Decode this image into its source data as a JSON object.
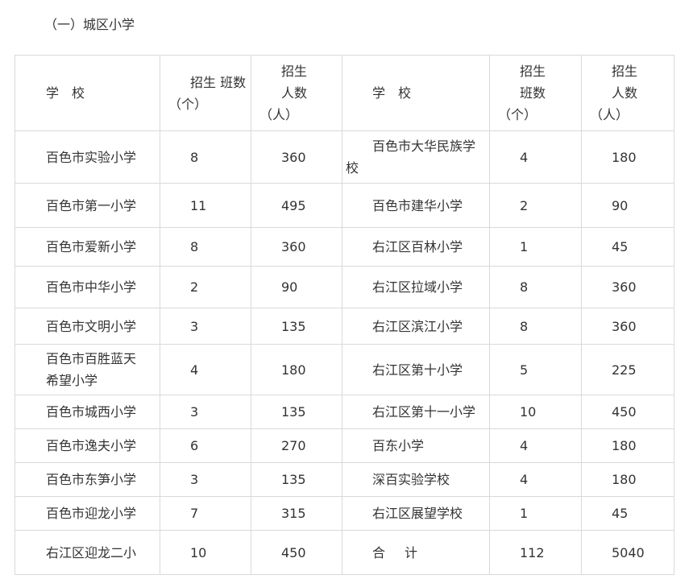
{
  "section_title": "（一）城区小学",
  "header": {
    "school": "学　校",
    "classes_line1": "招生 班数",
    "classes_line2": "（个）",
    "students_line1": "招生",
    "students_line2": "人数",
    "students_line3": "（人）",
    "school_right": "学　校",
    "classes_right_line1": "招生",
    "classes_right_line2": "班数",
    "classes_right_line3": "（个）",
    "students_right_line1": "招生",
    "students_right_line2": "人数",
    "students_right_line3": "（人）"
  },
  "rows": [
    {
      "school": "百色市实验小学",
      "classes": "8",
      "students": "360",
      "school2_a": "百色市大华民族学",
      "school2_b": "校",
      "classes2": "4",
      "students2": "180"
    },
    {
      "school": "百色市第一小学",
      "classes": "11",
      "students": "495",
      "school2": "百色市建华小学",
      "classes2": "2",
      "students2": "90"
    },
    {
      "school": "百色市爱新小学",
      "classes": "8",
      "students": "360",
      "school2": "右江区百林小学",
      "classes2": "1",
      "students2": "45"
    },
    {
      "school": "百色市中华小学",
      "classes": "2",
      "students": "90",
      "school2": "右江区拉域小学",
      "classes2": "8",
      "students2": "360"
    },
    {
      "school": "百色市文明小学",
      "classes": "3",
      "students": "135",
      "school2": "右江区滨江小学",
      "classes2": "8",
      "students2": "360"
    },
    {
      "school_a": "百色市百胜蓝天",
      "school_b": "希望小学",
      "classes": "4",
      "students": "180",
      "school2": "右江区第十小学",
      "classes2": "5",
      "students2": "225"
    },
    {
      "school": "百色市城西小学",
      "classes": "3",
      "students": "135",
      "school2": "右江区第十一小学",
      "classes2": "10",
      "students2": "450"
    },
    {
      "school": "百色市逸夫小学",
      "classes": "6",
      "students": "270",
      "school2": "百东小学",
      "classes2": "4",
      "students2": "180"
    },
    {
      "school": "百色市东笋小学",
      "classes": "3",
      "students": "135",
      "school2": "深百实验学校",
      "classes2": "4",
      "students2": "180"
    },
    {
      "school": "百色市迎龙小学",
      "classes": "7",
      "students": "315",
      "school2": "右江区展望学校",
      "classes2": "1",
      "students2": "45"
    },
    {
      "school": "右江区迎龙二小",
      "classes": "10",
      "students": "450",
      "total_label_a": "合",
      "total_label_b": "计",
      "classes2": "112",
      "students2": "5040"
    }
  ]
}
